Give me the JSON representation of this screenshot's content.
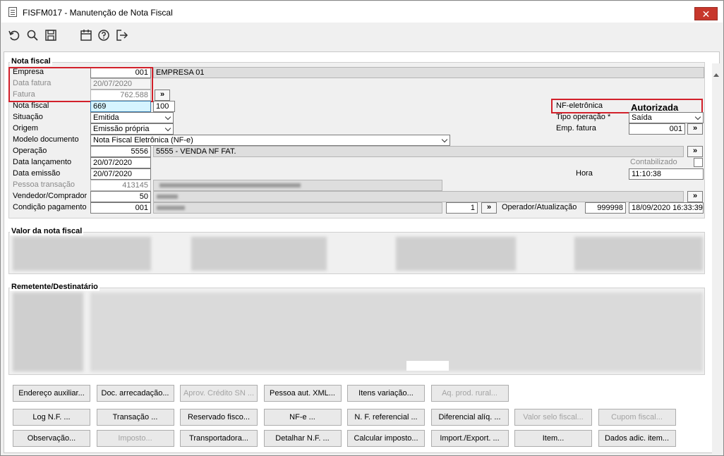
{
  "window": {
    "title": "FISFM017 - Manutenção de Nota Fiscal",
    "close_label": "✕"
  },
  "toolbar": {
    "icons": [
      "undo-icon",
      "search-icon",
      "save-icon",
      "calendar-icon",
      "help-icon",
      "exit-icon"
    ]
  },
  "nota_fiscal": {
    "section_title": "Nota fiscal",
    "empresa_label": "Empresa",
    "empresa_code": "001",
    "empresa_name": "EMPRESA 01",
    "data_fatura_label": "Data fatura",
    "data_fatura": "20/07/2020",
    "fatura_label": "Fatura",
    "fatura_value": "762.588",
    "nota_fiscal_label": "Nota fiscal",
    "nota_fiscal_value": "669",
    "serie_value": "100",
    "situacao_label": "Situação",
    "situacao_value": "Emitida",
    "origem_label": "Origem",
    "origem_value": "Emissão própria",
    "modelo_label": "Modelo documento",
    "modelo_value": "Nota Fiscal Eletrônica (NF-e)",
    "operacao_label": "Operação",
    "operacao_code": "5556",
    "operacao_desc": "5555 - VENDA NF FAT.",
    "data_lancamento_label": "Data lançamento",
    "data_lancamento": "20/07/2020",
    "data_emissao_label": "Data emissão",
    "data_emissao": "20/07/2020",
    "pessoa_label": "Pessoa transação",
    "pessoa_code": "413145",
    "vendedor_label": "Vendedor/Comprador",
    "vendedor_code": "50",
    "condicao_label": "Condição pagamento",
    "condicao_code": "001",
    "nfe_label": "NF-eletrônica",
    "nfe_status": "Autorizada",
    "tipo_operacao_label": "Tipo operação *",
    "tipo_operacao_value": "Saída",
    "emp_fatura_label": "Emp. fatura",
    "emp_fatura_value": "001",
    "contabilizado_label": "Contabilizado",
    "hora_label": "Hora",
    "hora_value": "11:10:38",
    "parcelas_value": "1",
    "operador_label": "Operador/Atualização",
    "operador_code": "999998",
    "atualizacao_value": "18/09/2020 16:33:39",
    "arrow": "»"
  },
  "valor": {
    "section_title": "Valor da nota fiscal"
  },
  "remetente": {
    "section_title": "Remetente/Destinatário"
  },
  "buttons": {
    "row1": [
      "Endereço auxiliar...",
      "Doc. arrecadação...",
      "Aprov. Crédito SN ...",
      "Pessoa aut. XML...",
      "Itens variação...",
      "Aq. prod. rural..."
    ],
    "row2": [
      "Log N.F. ...",
      "Transação ...",
      "Reservado fisco...",
      "NF-e ...",
      "N. F. referencial ...",
      "Diferencial alíq. ...",
      "Valor selo fiscal...",
      "Cupom fiscal..."
    ],
    "row3": [
      "Observação...",
      "Imposto...",
      "Transportadora...",
      "Detalhar N.F. ...",
      "Calcular imposto...",
      "Import./Export. ...",
      "Item...",
      "Dados adic. item..."
    ]
  }
}
